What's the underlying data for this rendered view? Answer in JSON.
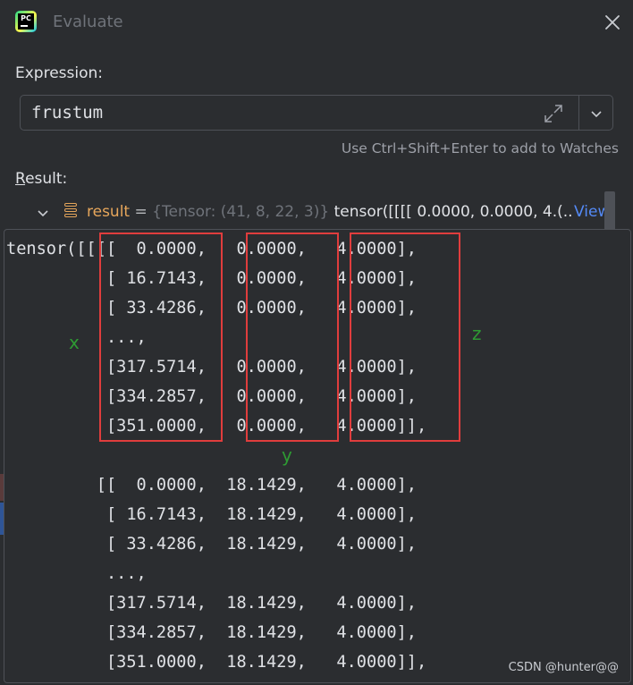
{
  "window": {
    "title": "Evaluate",
    "app_icon_text": "PC"
  },
  "expression": {
    "label": "Expression:",
    "value": "frustum",
    "hint": "Use Ctrl+Shift+Enter to add to Watches"
  },
  "result": {
    "label_underlined": "R",
    "label_rest": "esult:",
    "name": "result",
    "equals": " = ",
    "type": "{Tensor: (41, 8, 22, 3)}",
    "value": " tensor([[[[  0.0000,   0.0000,   4.(...",
    "view_link": "View"
  },
  "tensor_popup": {
    "lines": [
      "tensor([[[[  0.0000,   0.0000,   4.0000],",
      "          [ 16.7143,   0.0000,   4.0000],",
      "          [ 33.4286,   0.0000,   4.0000],",
      "          ...,",
      "          [317.5714,   0.0000,   4.0000],",
      "          [334.2857,   0.0000,   4.0000],",
      "          [351.0000,   0.0000,   4.0000]],",
      "",
      "         [[  0.0000,  18.1429,   4.0000],",
      "          [ 16.7143,  18.1429,   4.0000],",
      "          [ 33.4286,  18.1429,   4.0000],",
      "          ...,",
      "          [317.5714,  18.1429,   4.0000],",
      "          [334.2857,  18.1429,   4.0000],",
      "          [351.0000,  18.1429,   4.0000]],"
    ],
    "annotations": {
      "x": "x",
      "y": "y",
      "z": "z"
    }
  },
  "watermark": "CSDN @hunter@@",
  "colors": {
    "background": "#2b2d30",
    "text": "#dfe1e5",
    "variable_name": "#e6a65b",
    "type_text": "#6f737a",
    "link": "#548af7",
    "highlight_box": "#e03d3d",
    "annotation": "#2e9a33"
  },
  "icons": {
    "close": "close-icon",
    "expand": "expand-icon",
    "dropdown": "chevron-down-icon",
    "tree_toggle": "chevron-down-icon",
    "variable": "stack-icon"
  }
}
